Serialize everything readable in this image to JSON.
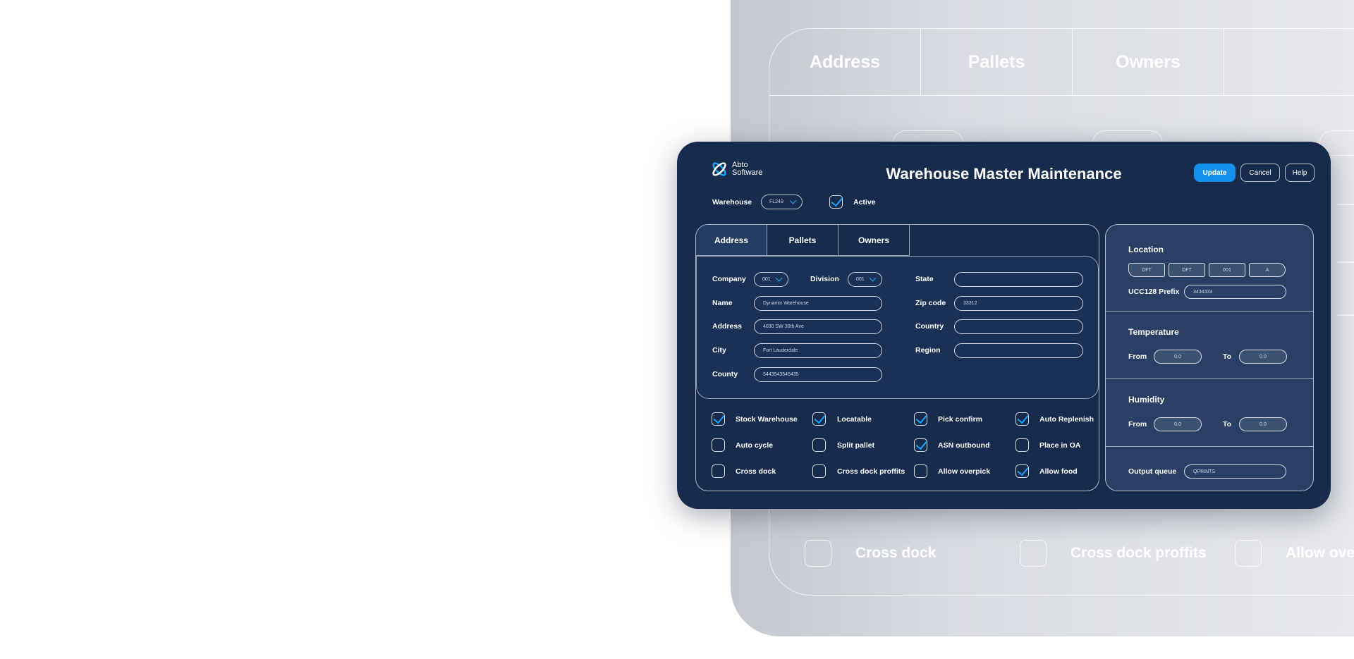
{
  "ghost": {
    "tabs": [
      "Address",
      "Pallets",
      "Owners"
    ],
    "rows": [
      {
        "label_1": "Cross dock",
        "label_2": "Cross dock proffits",
        "label_3": "Allow ove"
      }
    ]
  },
  "app": {
    "logo_line1": "Abto",
    "logo_line2": "Software",
    "title": "Warehouse Master Maintenance",
    "buttons": {
      "update": "Update",
      "cancel": "Cancel",
      "help": "Help"
    },
    "warehouse_label": "Warehouse",
    "warehouse_value": "FL249",
    "active_label": "Active",
    "active_checked": true
  },
  "tabs": [
    {
      "label": "Address",
      "active": true
    },
    {
      "label": "Pallets",
      "active": false
    },
    {
      "label": "Owners",
      "active": false
    }
  ],
  "address": {
    "company_label": "Company",
    "company_value": "001",
    "division_label": "Division",
    "division_value": "001",
    "name_label": "Name",
    "name_value": "Dynamix Warehouse",
    "address_label": "Address",
    "address_value": "4030 SW 30th Ave",
    "city_label": "City",
    "city_value": "Fort Lauderdale",
    "county_label": "County",
    "county_value": "544354354543​5",
    "state_label": "State",
    "state_value": "",
    "zip_label": "Zip code",
    "zip_value": "33312",
    "country_label": "Country",
    "country_value": "",
    "region_label": "Region",
    "region_value": ""
  },
  "options": [
    {
      "label": "Stock Warehouse",
      "checked": true
    },
    {
      "label": "Locatable",
      "checked": true
    },
    {
      "label": "Pick confirm",
      "checked": true
    },
    {
      "label": "Auto Replenish",
      "checked": true
    },
    {
      "label": "Auto cycle",
      "checked": false
    },
    {
      "label": "Split pallet",
      "checked": false
    },
    {
      "label": "ASN outbound",
      "checked": true
    },
    {
      "label": "Place in OA",
      "checked": false
    },
    {
      "label": "Cross dock",
      "checked": false
    },
    {
      "label": "Cross dock proffits",
      "checked": false
    },
    {
      "label": "Allow overpick",
      "checked": false
    },
    {
      "label": "Allow food",
      "checked": true
    }
  ],
  "location": {
    "heading": "Location",
    "segments": [
      "DFT",
      "DFT",
      "001",
      "A"
    ],
    "ucc_label": "UCC128 Prefix",
    "ucc_value": "3434333"
  },
  "temperature": {
    "heading": "Temperature",
    "from_label": "From",
    "from_value": "0.0",
    "to_label": "To",
    "to_value": "0.0"
  },
  "humidity": {
    "heading": "Humidity",
    "from_label": "From",
    "from_value": "0.0",
    "to_label": "To",
    "to_value": "0.0"
  },
  "output_queue": {
    "label": "Output queue",
    "value": "QPRINTS"
  },
  "colors": {
    "card": "#172b4d",
    "accent": "#1292ee",
    "check": "#1aa3ff"
  }
}
